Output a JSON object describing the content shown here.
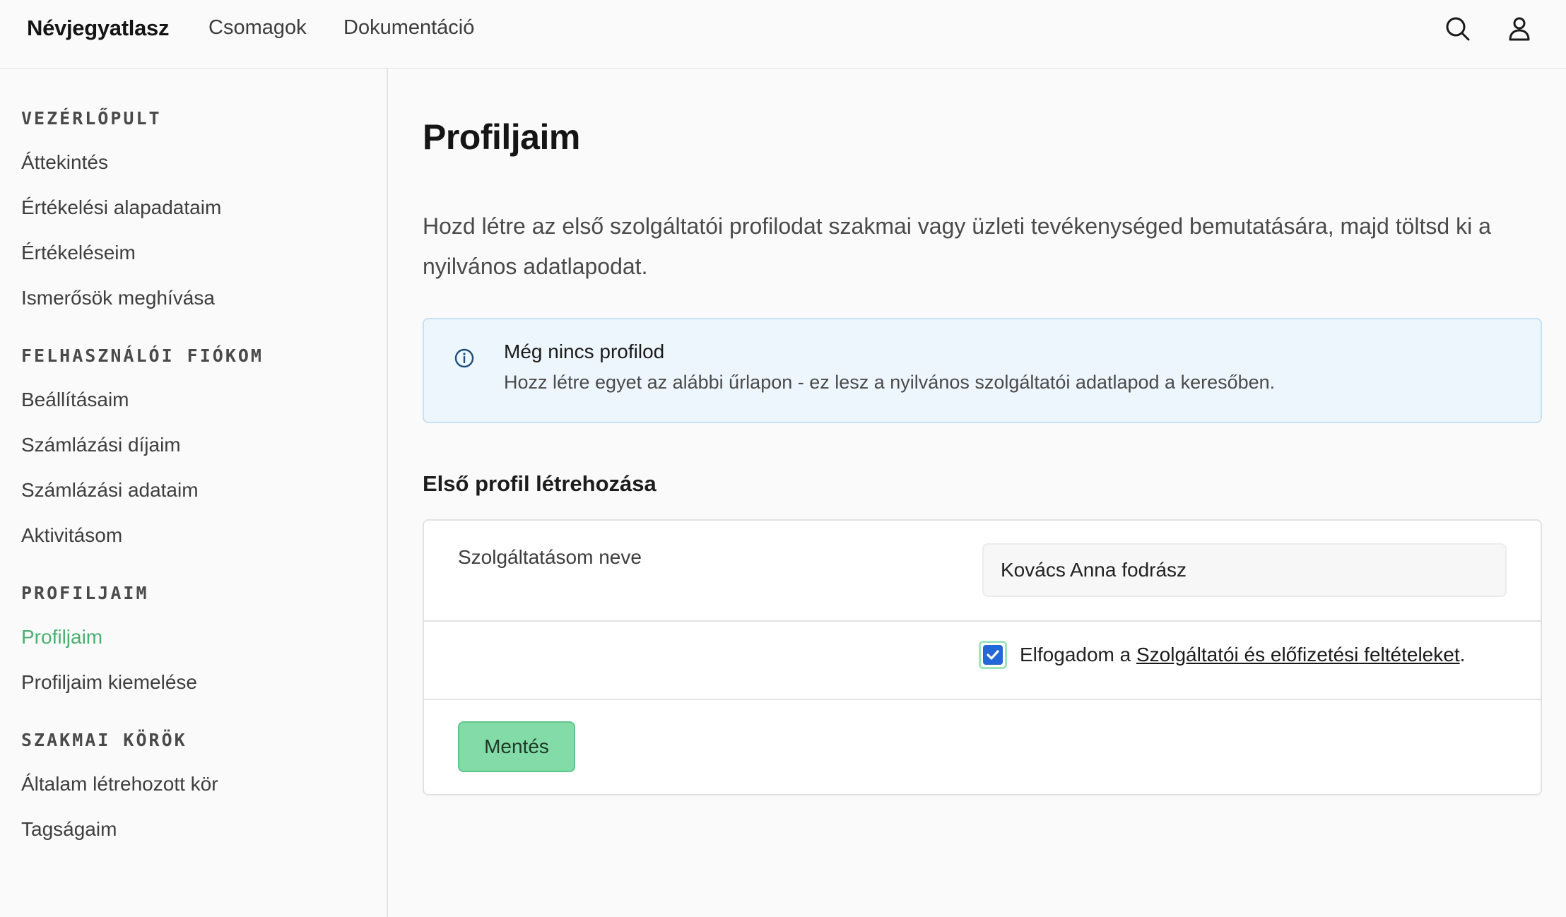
{
  "header": {
    "brand": "Névjegyatlasz",
    "nav": [
      "Csomagok",
      "Dokumentáció"
    ],
    "icons": [
      "search-icon",
      "user-icon"
    ]
  },
  "sidebar": {
    "sections": [
      {
        "heading": "VEZÉRLŐPULT",
        "items": [
          "Áttekintés",
          "Értékelési alapadataim",
          "Értékeléseim",
          "Ismerősök meghívása"
        ]
      },
      {
        "heading": "FELHASZNÁLÓI FIÓKOM",
        "items": [
          "Beállításaim",
          "Számlázási díjaim",
          "Számlázási adataim",
          "Aktivitásom"
        ]
      },
      {
        "heading": "PROFILJAIM",
        "items": [
          "Profiljaim",
          "Profiljaim kiemelése"
        ]
      },
      {
        "heading": "SZAKMAI KÖRÖK",
        "items": [
          "Általam létrehozott kör",
          "Tagságaim"
        ]
      }
    ],
    "active_item": "Profiljaim"
  },
  "main": {
    "title": "Profiljaim",
    "intro": "Hozd létre az első szolgáltatói profilodat szakmai vagy üzleti tevékenységed bemutatására, majd töltsd ki a nyilvános adatlapodat.",
    "info": {
      "title": "Még nincs profilod",
      "text": "Hozz létre egyet az alábbi űrlapon - ez lesz a nyilvános szolgáltatói adatlapod a keresőben."
    },
    "form": {
      "section_title": "Első profil létrehozása",
      "name_label": "Szolgáltatásom neve",
      "name_value": "Kovács Anna fodrász",
      "consent_prefix": "Elfogadom a ",
      "consent_link": "Szolgáltatói és előfizetési feltételeket",
      "consent_suffix": ".",
      "consent_checked": true,
      "save_label": "Mentés"
    }
  },
  "colors": {
    "accent_green": "#4caf72",
    "button_green": "#83dba7",
    "info_bg": "#eef6fd",
    "checkbox_blue": "#2467d8"
  }
}
